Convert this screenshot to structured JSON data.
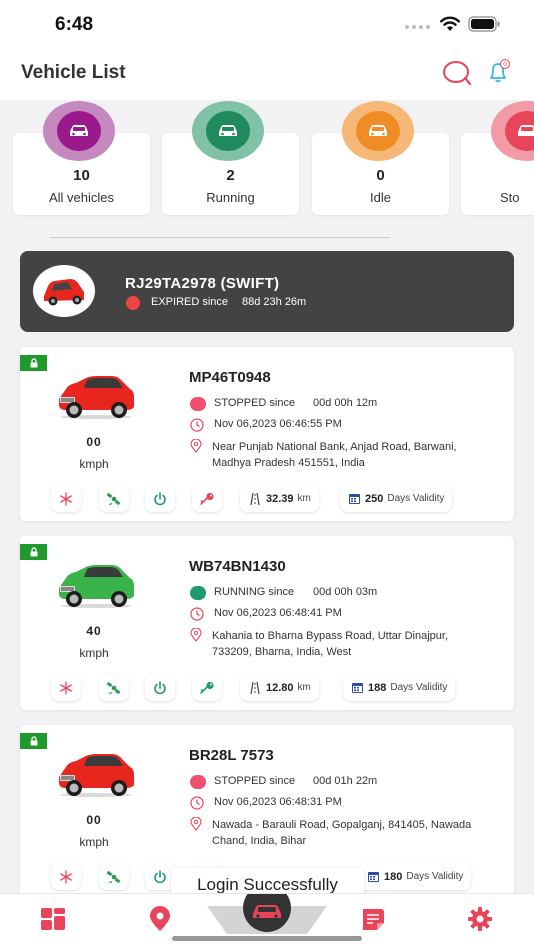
{
  "status_bar": {
    "time": "6:48"
  },
  "header": {
    "title": "Vehicle List"
  },
  "summary": [
    {
      "count": "10",
      "label": "All vehicles",
      "color": "#9a1a8e",
      "halo": "#c689bf"
    },
    {
      "count": "2",
      "label": "Running",
      "color": "#1e8a5e",
      "halo": "#7fc2a6"
    },
    {
      "count": "0",
      "label": "Idle",
      "color": "#f08c26",
      "halo": "#f6b877"
    },
    {
      "count": "",
      "label": "Sto",
      "color": "#e8445a",
      "halo": "#f29ba6"
    }
  ],
  "expired": {
    "plate": "RJ29TA2978 (SWIFT)",
    "status": "EXPIRED since",
    "duration": "88d 23h 26m"
  },
  "vehicles": [
    {
      "plate": "MP46T0948",
      "speed": "00",
      "speed_unit": "kmph",
      "car_color": "#e8251f",
      "status": "STOPPED since",
      "status_color": "#f0506e",
      "duration": "00d 00h 12m",
      "timestamp": "Nov 06,2023 06:46:55 PM",
      "address": "Near Punjab National Bank, Anjad Road, Barwani, Madhya Pradesh 451551, India",
      "distance": "32.39",
      "distance_unit": "km",
      "validity_days": "250",
      "validity_label": "Days Validity",
      "key_color": "#e8445a"
    },
    {
      "plate": "WB74BN1430",
      "speed": "40",
      "speed_unit": "kmph",
      "car_color": "#39b34a",
      "status": "RUNNING since",
      "status_color": "#1e9a6e",
      "duration": "00d 00h 03m",
      "timestamp": "Nov 06,2023 06:48:41 PM",
      "address": "Kahania to Bharna Bypass Road, Uttar Dinajpur, 733209, Bharna, India, West",
      "distance": "12.80",
      "distance_unit": "km",
      "validity_days": "188",
      "validity_label": "Days Validity",
      "key_color": "#1e9a6e"
    },
    {
      "plate": "BR28L 7573",
      "speed": "00",
      "speed_unit": "kmph",
      "car_color": "#e8251f",
      "status": "STOPPED since",
      "status_color": "#f0506e",
      "duration": "00d 01h 22m",
      "timestamp": "Nov 06,2023 06:48:31 PM",
      "address": "Nawada - Barauli Road, Gopalganj, 841405, Nawada Chand, India, Bihar",
      "distance": "",
      "distance_unit": "",
      "validity_days": "180",
      "validity_label": "Days Validity",
      "key_color": "#e8445a"
    }
  ],
  "toast": "Login Successfully",
  "tabs": [
    "dashboard-icon",
    "map-pin-icon",
    "car-icon",
    "report-icon",
    "settings-icon"
  ],
  "colors": {
    "accent": "#e8445a",
    "dark_card": "#434343",
    "lock_badge": "#1e9a2c"
  }
}
